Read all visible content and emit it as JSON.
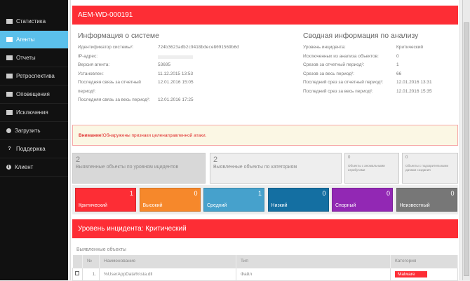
{
  "sidebar": {
    "items": [
      {
        "label": "Статистика",
        "icon": "chart-icon"
      },
      {
        "label": "Агенты",
        "icon": "monitor-icon",
        "active": true
      },
      {
        "label": "Отчеты",
        "icon": "list-icon"
      },
      {
        "label": "Ретроспектива",
        "icon": "grid-icon"
      },
      {
        "label": "Оповещения",
        "icon": "envelope-icon"
      },
      {
        "label": "Исключения",
        "icon": "list-icon"
      },
      {
        "label": "Загрузить",
        "icon": "gear-icon"
      },
      {
        "label": "Поддержка",
        "icon": "question-icon"
      },
      {
        "label": "Клиент",
        "icon": "info-icon"
      }
    ]
  },
  "header": {
    "title": "AEM-WD-000191"
  },
  "system": {
    "title": "Информация о системе",
    "rows": [
      {
        "k": "Идентификатор системы²:",
        "v": "724b3623adb2c9418bdece8091569b6d"
      },
      {
        "k": "IP-адрес:",
        "v": ""
      },
      {
        "k": "Версия агента:",
        "v": "53695"
      },
      {
        "k": "Установлен:",
        "v": "11.12.2015 13:53"
      },
      {
        "k": "Последняя связь за отчетный период²:",
        "v": "12.01.2016 15:05"
      },
      {
        "k": "Последняя связь за весь период²:",
        "v": "12.01.2016 17:25"
      }
    ]
  },
  "analysis": {
    "title": "Сводная информация по анализу",
    "rows": [
      {
        "k": "Уровень инцидента:",
        "v": "Критический"
      },
      {
        "k": "Исключенных из анализа объектов:",
        "v": "0"
      },
      {
        "k": "Срезов за отчетный период²:",
        "v": "1"
      },
      {
        "k": "Срезов за весь период²:",
        "v": "66"
      },
      {
        "k": "Последний срез за отчетный период²:",
        "v": "12.01.2016 13:31"
      },
      {
        "k": "Последний срез за весь период²:",
        "v": "12.01.2016 15:35"
      }
    ]
  },
  "alert": {
    "strong": "Внимание!",
    "text": " Обнаружены признаки целенаправленной атаки."
  },
  "cards": [
    {
      "n": "2",
      "t": "Выявленные объекты по уровням ицидентов"
    },
    {
      "n": "2",
      "t": "Выявленные объекты по категориям"
    },
    {
      "n": "0",
      "t": "Объекты с аномальными атрибутами"
    },
    {
      "n": "0",
      "t": "Объекты с подозрительными датами создания"
    }
  ],
  "levels": [
    {
      "label": "Критический",
      "count": "1",
      "color": "#fd2d35"
    },
    {
      "label": "Высокий",
      "count": "0",
      "color": "#f6882b"
    },
    {
      "label": "Средний",
      "count": "1",
      "color": "#46a1cc"
    },
    {
      "label": "Низкий",
      "count": "0",
      "color": "#146fa2"
    },
    {
      "label": "Спорный",
      "count": "0",
      "color": "#9228b4"
    },
    {
      "label": "Неизвестный",
      "count": "0",
      "color": "#777777"
    }
  ],
  "incident": {
    "title": "Уровень инцидента: Критический",
    "subtitle": "Выявленные объекты"
  },
  "table": {
    "headers": [
      "№",
      "Наименование",
      "Тип",
      "Категория"
    ],
    "rows": [
      {
        "num": "1.",
        "name": "%UserAppData%\\sta.dll",
        "type": "Файл",
        "category": "Malware"
      }
    ]
  }
}
